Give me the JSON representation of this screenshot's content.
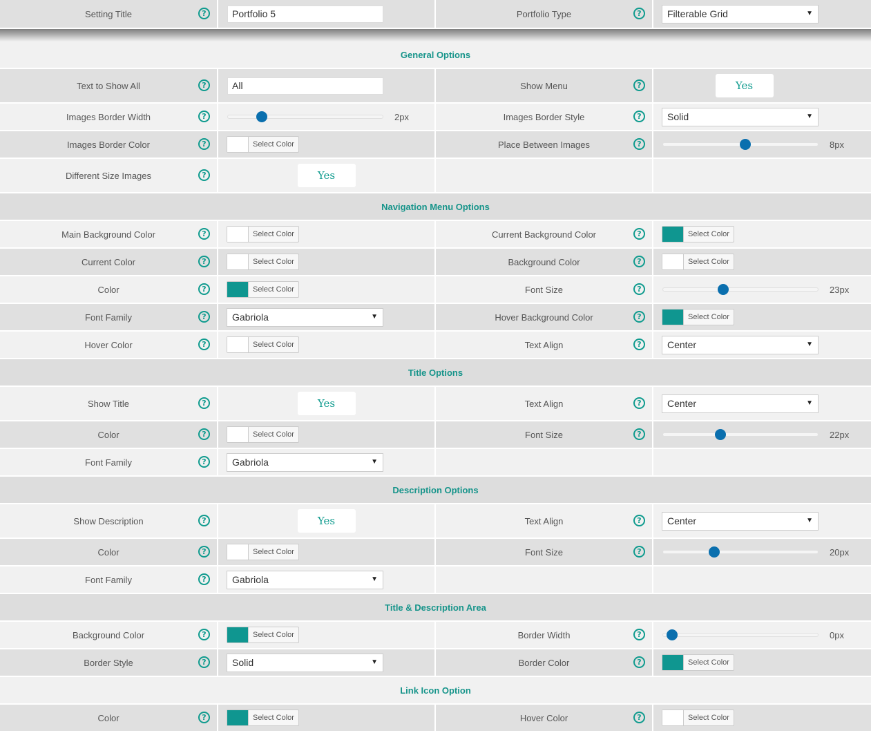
{
  "top": {
    "setting_title_label": "Setting Title",
    "setting_title_value": "Portfolio 5",
    "portfolio_type_label": "Portfolio Type",
    "portfolio_type_value": "Filterable Grid"
  },
  "general": {
    "heading": "General Options",
    "text_show_all_label": "Text to Show All",
    "text_show_all_value": "All",
    "show_menu_label": "Show Menu",
    "show_menu_value": "Yes",
    "border_width_label": "Images Border Width",
    "border_width_value": "2px",
    "border_width_level": 0.22,
    "border_style_label": "Images Border Style",
    "border_style_value": "Solid",
    "border_color_label": "Images Border Color",
    "border_color_btn": "Select Color",
    "border_color_swatch": "#ffffff",
    "place_between_label": "Place Between Images",
    "place_between_value": "8px",
    "place_between_level": 0.53,
    "diff_size_label": "Different Size Images",
    "diff_size_value": "Yes"
  },
  "nav": {
    "heading": "Navigation Menu Options",
    "main_bg_label": "Main Background Color",
    "main_bg_btn": "Select Color",
    "main_bg_swatch": "#ffffff",
    "cur_bg_label": "Current Background Color",
    "cur_bg_btn": "Select Color",
    "cur_bg_swatch": "#0f9690",
    "cur_color_label": "Current Color",
    "cur_color_btn": "Select Color",
    "cur_color_swatch": "#ffffff",
    "bg_color_label": "Background Color",
    "bg_color_btn": "Select Color",
    "bg_color_swatch": "#ffffff",
    "color_label": "Color",
    "color_btn": "Select Color",
    "color_swatch": "#0f9690",
    "font_size_label": "Font Size",
    "font_size_value": "23px",
    "font_size_level": 0.39,
    "font_family_label": "Font Family",
    "font_family_value": "Gabriola",
    "hover_bg_label": "Hover Background Color",
    "hover_bg_btn": "Select Color",
    "hover_bg_swatch": "#0f9690",
    "hover_color_label": "Hover Color",
    "hover_color_btn": "Select Color",
    "hover_color_swatch": "#ffffff",
    "text_align_label": "Text Align",
    "text_align_value": "Center"
  },
  "title": {
    "heading": "Title Options",
    "show_title_label": "Show Title",
    "show_title_value": "Yes",
    "text_align_label": "Text Align",
    "text_align_value": "Center",
    "color_label": "Color",
    "color_btn": "Select Color",
    "color_swatch": "#ffffff",
    "font_size_label": "Font Size",
    "font_size_value": "22px",
    "font_size_level": 0.37,
    "font_family_label": "Font Family",
    "font_family_value": "Gabriola"
  },
  "desc": {
    "heading": "Description Options",
    "show_desc_label": "Show Description",
    "show_desc_value": "Yes",
    "text_align_label": "Text Align",
    "text_align_value": "Center",
    "color_label": "Color",
    "color_btn": "Select Color",
    "color_swatch": "#ffffff",
    "font_size_label": "Font Size",
    "font_size_value": "20px",
    "font_size_level": 0.33,
    "font_family_label": "Font Family",
    "font_family_value": "Gabriola"
  },
  "area": {
    "heading": "Title & Description Area",
    "bg_color_label": "Background Color",
    "bg_color_btn": "Select Color",
    "bg_color_swatch": "#0f9690",
    "border_width_label": "Border Width",
    "border_width_value": "0px",
    "border_width_level": 0.06,
    "border_style_label": "Border Style",
    "border_style_value": "Solid",
    "border_color_label": "Border Color",
    "border_color_btn": "Select Color",
    "border_color_swatch": "#0f9690"
  },
  "link": {
    "heading": "Link Icon Option",
    "color_label": "Color",
    "color_btn": "Select Color",
    "color_swatch": "#0f9690",
    "hover_color_label": "Hover Color",
    "hover_color_btn": "Select Color",
    "hover_color_swatch": "#ffffff"
  },
  "help_glyph": "?",
  "select_arrow": "▼"
}
